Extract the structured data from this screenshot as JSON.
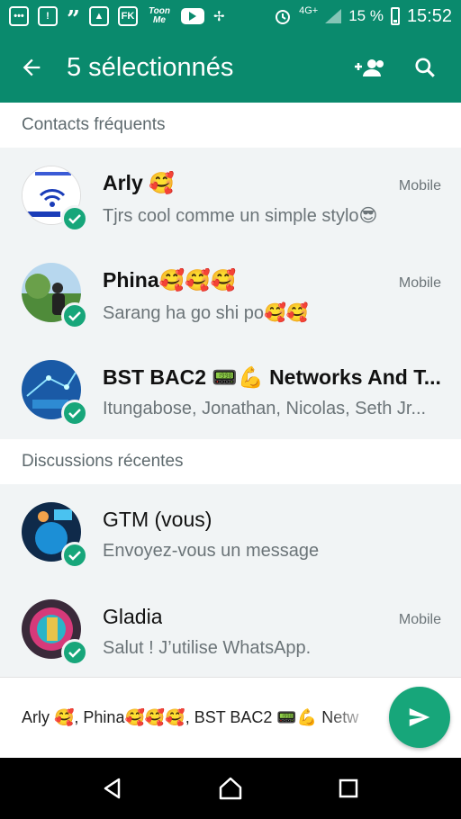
{
  "status_bar": {
    "icons": [
      "messages-icon",
      "alert-icon",
      "quote-icon",
      "gallery-icon",
      "fk-icon",
      "toonme-icon",
      "youtube-icon",
      "pinwheel-icon"
    ],
    "fk_label": "FK",
    "toon_label": "Toon Me",
    "network": "4G+",
    "battery": "15 %",
    "time": "15:52"
  },
  "app_bar": {
    "title": "5 sélectionnés",
    "actions": [
      "add-group-icon",
      "search-icon"
    ]
  },
  "sections": {
    "frequent": "Contacts fréquents",
    "recent": "Discussions récentes"
  },
  "frequent_contacts": [
    {
      "name": "Arly 🥰",
      "label": "Mobile",
      "status": "Tjrs cool comme un simple stylo😎",
      "selected": true
    },
    {
      "name": "Phina🥰🥰🥰",
      "label": "Mobile",
      "status": "Sarang ha go shi po🥰🥰",
      "selected": true
    },
    {
      "name": "BST BAC2 📟💪 Networks And T...",
      "label": "",
      "status": "Itungabose, Jonathan, Nicolas, Seth Jr...",
      "selected": true
    }
  ],
  "recent_chats": [
    {
      "name": "GTM (vous)",
      "label": "",
      "status": "Envoyez-vous un message",
      "selected": true
    },
    {
      "name": "Gladia",
      "label": "Mobile",
      "status": "Salut ! J’utilise WhatsApp.",
      "selected": true
    }
  ],
  "bottom_bar": {
    "selected_names": "Arly 🥰, Phina🥰🥰🥰, BST BAC2 📟💪 Netw"
  },
  "colors": {
    "primary": "#0a8a6d",
    "accent": "#17a67a",
    "background": "#f1f4f5"
  },
  "nav_bar": [
    "back-icon",
    "home-icon",
    "recents-icon"
  ]
}
